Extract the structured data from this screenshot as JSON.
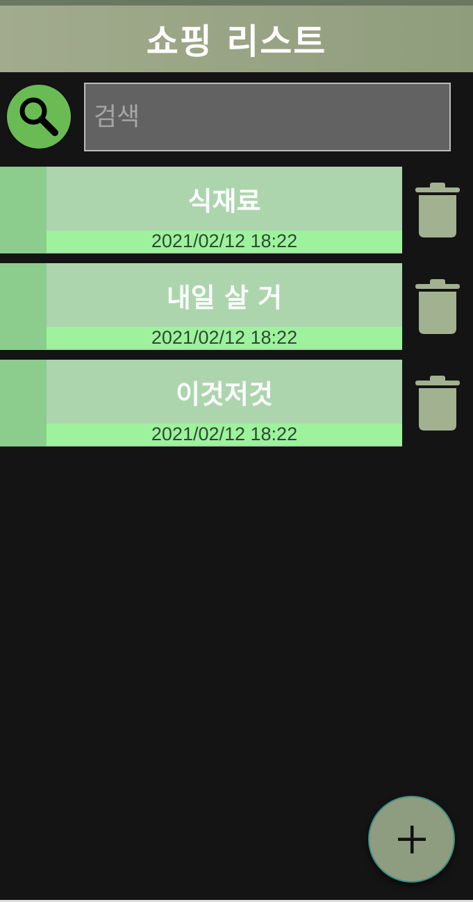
{
  "app": {
    "title": "쇼핑 리스트"
  },
  "search": {
    "placeholder": "검색",
    "value": "",
    "icon": "search-icon"
  },
  "items": [
    {
      "title": "식재료",
      "date": "2021/02/12 18:22"
    },
    {
      "title": "내일 살 거",
      "date": "2021/02/12 18:22"
    },
    {
      "title": "이것저것",
      "date": "2021/02/12 18:22"
    }
  ],
  "icons": {
    "delete": "trash-icon",
    "add": "plus-icon"
  },
  "colors": {
    "appbar": "#96a383",
    "background": "#141414",
    "card": "#acd5ae",
    "card_stripe": "#8ccc8c",
    "date_bar": "#9ef29e",
    "search_button": "#6bbb55",
    "trash": "#a2b290",
    "fab": "#8e9c80"
  }
}
